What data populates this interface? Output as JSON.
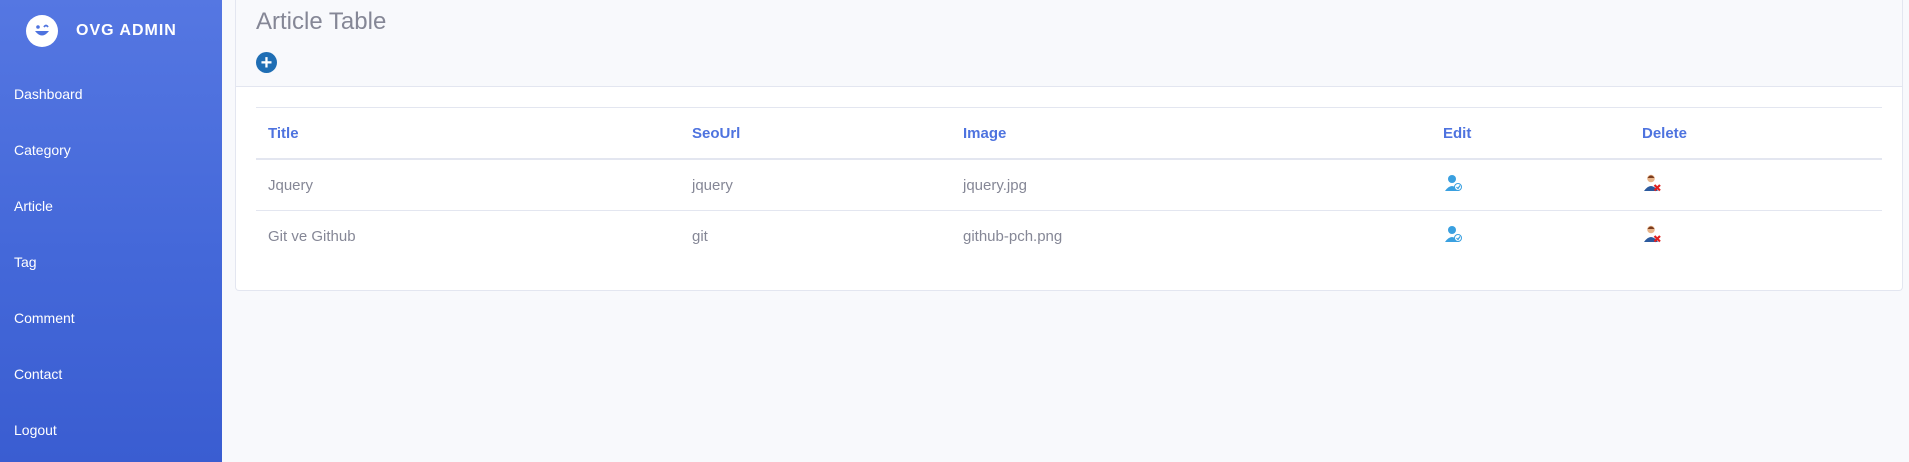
{
  "brand": {
    "name": "OVG ADMIN"
  },
  "sidebar": {
    "items": [
      {
        "label": "Dashboard"
      },
      {
        "label": "Category"
      },
      {
        "label": "Article"
      },
      {
        "label": "Tag"
      },
      {
        "label": "Comment"
      },
      {
        "label": "Contact"
      },
      {
        "label": "Logout"
      }
    ]
  },
  "page": {
    "title": "Article Table"
  },
  "table": {
    "headers": [
      "Title",
      "SeoUrl",
      "Image",
      "Edit",
      "Delete"
    ],
    "rows": [
      {
        "title": "Jquery",
        "seourl": "jquery",
        "image": "jquery.jpg"
      },
      {
        "title": "Git ve Github",
        "seourl": "git",
        "image": "github-pch.png"
      }
    ]
  },
  "colors": {
    "sidebar": "#4e73df",
    "accent": "#4e73df",
    "text": "#858796",
    "add_button": "#1f6eb4"
  },
  "icons": {
    "brand": "laugh-wink-icon",
    "add": "plus-circle-icon",
    "edit": "user-edit-icon",
    "delete": "user-delete-icon"
  }
}
